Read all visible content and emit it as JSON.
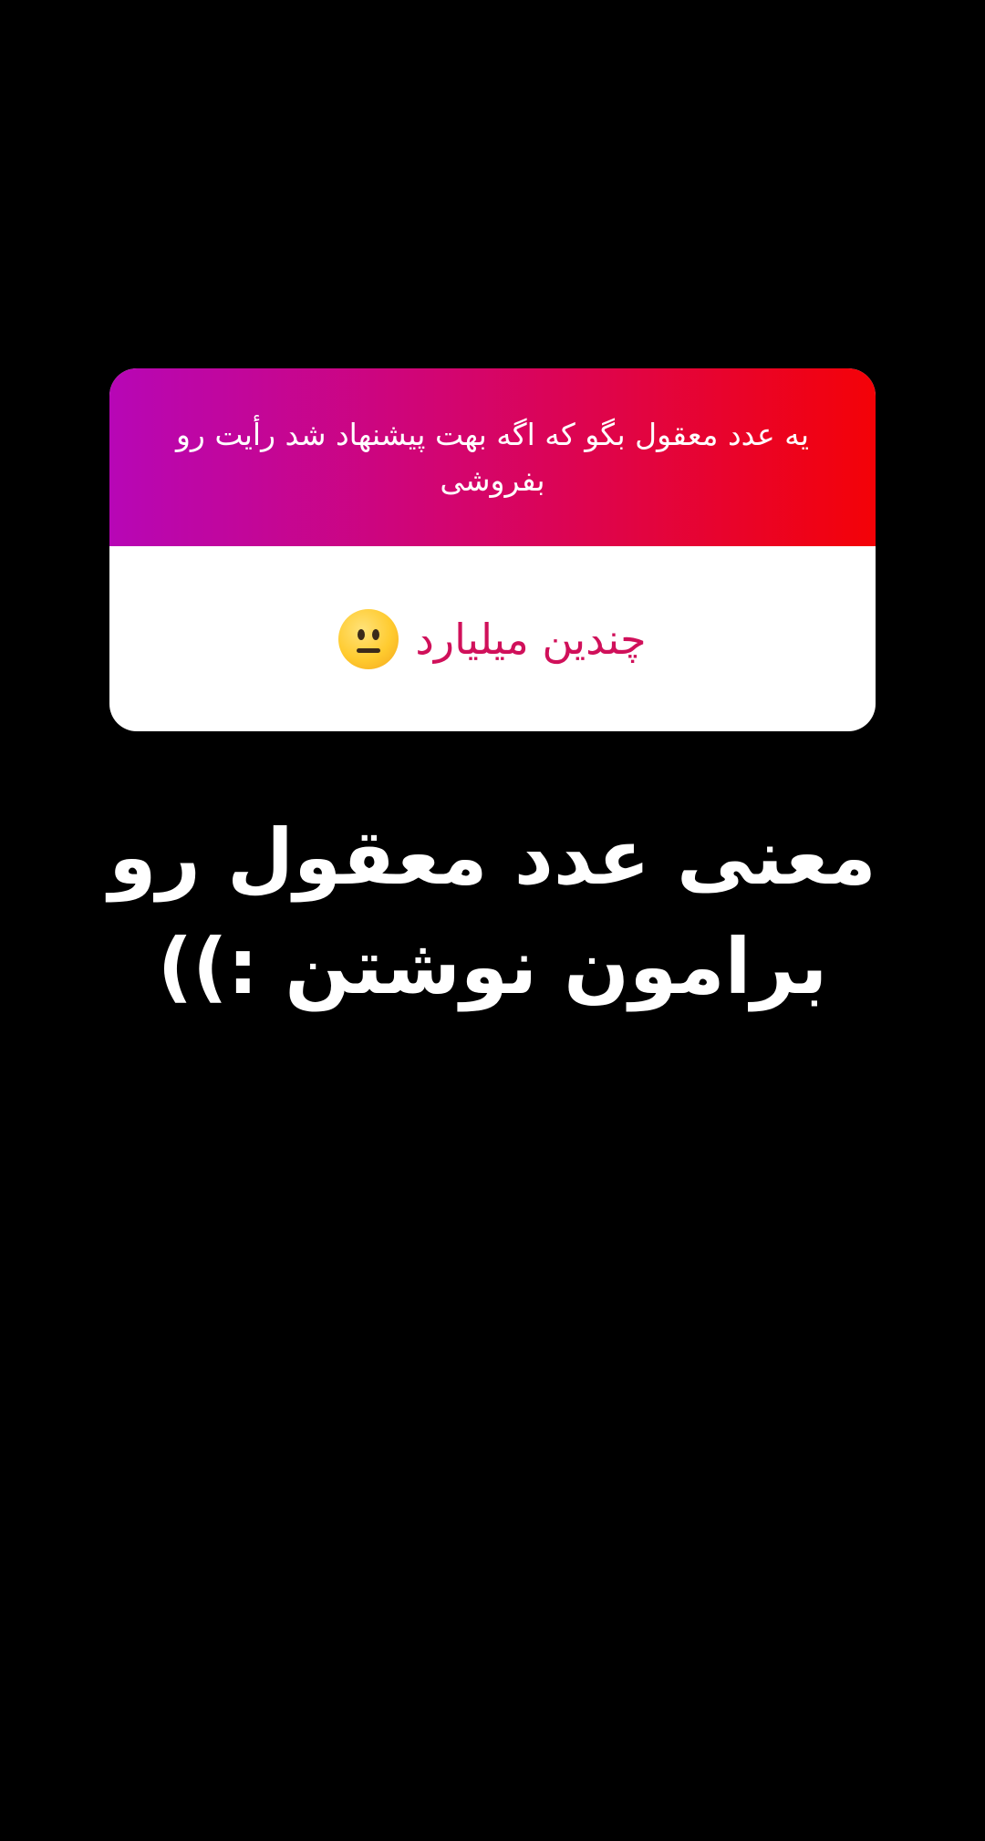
{
  "question_card": {
    "question": "یه عدد معقول بگو که اگه بهت پیشنهاد شد رأیت رو بفروشی",
    "answer": "چندین میلیارد",
    "answer_emoji": "neutral-face-icon",
    "colors": {
      "gradient_start": "#b706b6",
      "gradient_end": "#f40207",
      "answer_text": "#d0105a"
    }
  },
  "caption": {
    "text": "معنی عدد معقول رو برامون نوشتن :))"
  },
  "background_color": "#000000"
}
